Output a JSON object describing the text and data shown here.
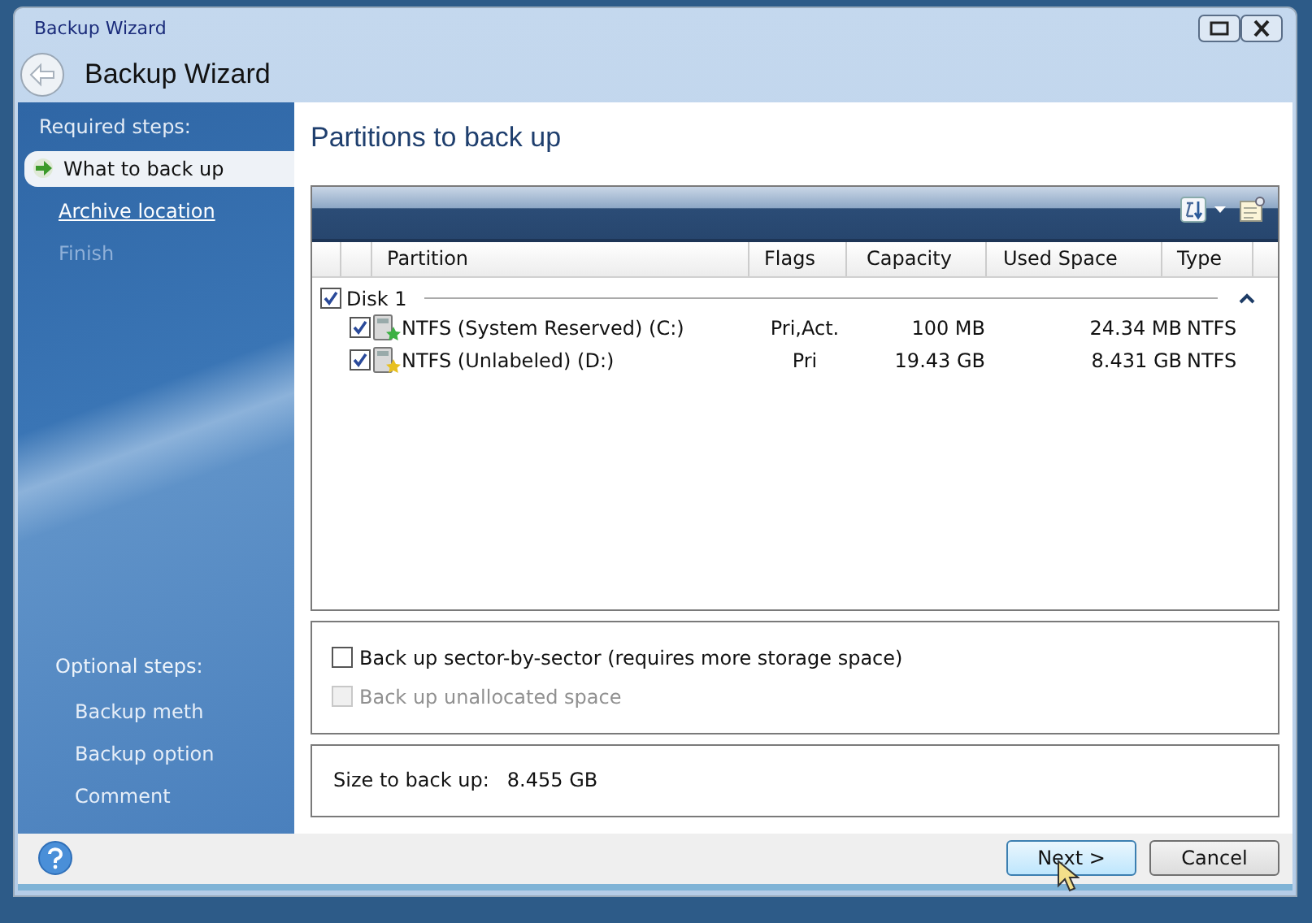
{
  "window": {
    "title": "Backup Wizard",
    "heading": "Backup Wizard"
  },
  "sidebar": {
    "required_label": "Required steps:",
    "required_steps": [
      {
        "label": "What to back up",
        "selected": true,
        "disabled": false
      },
      {
        "label": "Archive location",
        "selected": false,
        "disabled": false
      },
      {
        "label": "Finish",
        "selected": false,
        "disabled": true
      }
    ],
    "optional_label": "Optional steps:",
    "optional_steps": [
      {
        "label": "Backup meth"
      },
      {
        "label": "Backup option"
      },
      {
        "label": "Comment"
      }
    ]
  },
  "page_title": "Partitions to back up",
  "table": {
    "columns": [
      "Partition",
      "Flags",
      "Capacity",
      "Used Space",
      "Type"
    ],
    "disks": [
      {
        "label": "Disk 1",
        "checked": true,
        "expanded": true,
        "partitions": [
          {
            "name": "NTFS (System Reserved) (C:)",
            "checked": true,
            "color": "#3cb043",
            "flags": "Pri,Act.",
            "capacity": "100 MB",
            "used_space": "24.34 MB",
            "type": "NTFS"
          },
          {
            "name": "NTFS (Unlabeled) (D:)",
            "checked": true,
            "color": "#e8c020",
            "flags": "Pri",
            "capacity": "19.43 GB",
            "used_space": "8.431 GB",
            "type": "NTFS"
          }
        ]
      }
    ]
  },
  "options": [
    {
      "label": "Back up sector-by-sector (requires more storage space)",
      "checked": false,
      "disabled": false
    },
    {
      "label": "Back up unallocated space",
      "checked": false,
      "disabled": true
    }
  ],
  "summary": {
    "label": "Size to back up:",
    "value": "8.455 GB"
  },
  "buttons": [
    {
      "label": "Next >",
      "kind": "primary",
      "hovered": true
    },
    {
      "label": "Cancel",
      "kind": "secondary",
      "hovered": false
    }
  ]
}
